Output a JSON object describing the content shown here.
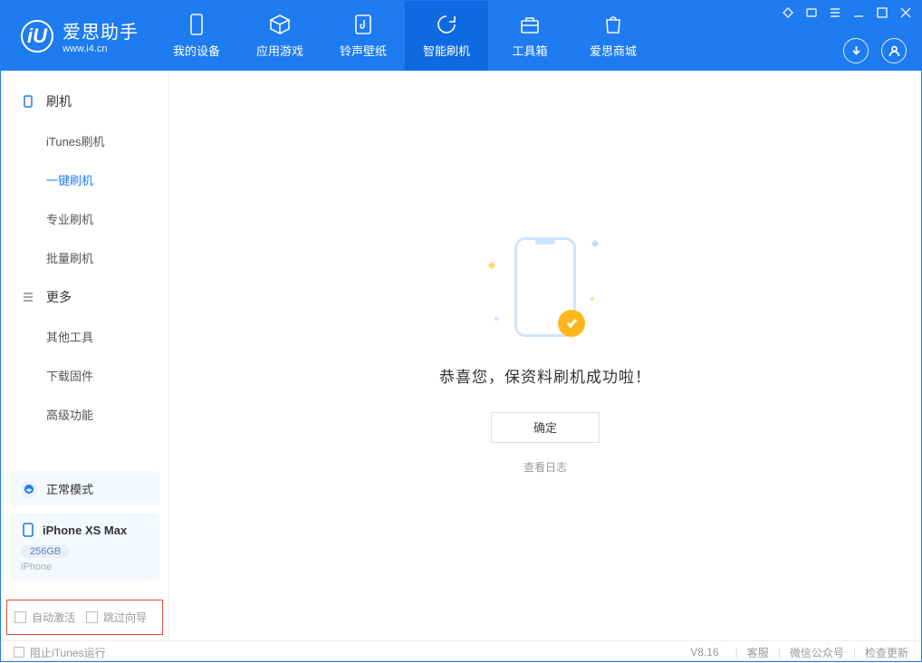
{
  "app": {
    "title": "爱思助手",
    "subtitle": "www.i4.cn",
    "logo_letter": "iU"
  },
  "nav": {
    "tabs": [
      {
        "label": "我的设备",
        "icon": "device"
      },
      {
        "label": "应用游戏",
        "icon": "cube"
      },
      {
        "label": "铃声壁纸",
        "icon": "music"
      },
      {
        "label": "智能刷机",
        "icon": "refresh",
        "active": true
      },
      {
        "label": "工具箱",
        "icon": "toolbox"
      },
      {
        "label": "爱思商城",
        "icon": "bag"
      }
    ]
  },
  "sidebar": {
    "group_flash": {
      "label": "刷机"
    },
    "items_flash": [
      {
        "label": "iTunes刷机"
      },
      {
        "label": "一键刷机",
        "active": true
      },
      {
        "label": "专业刷机"
      },
      {
        "label": "批量刷机"
      }
    ],
    "group_more": {
      "label": "更多"
    },
    "items_more": [
      {
        "label": "其他工具"
      },
      {
        "label": "下载固件"
      },
      {
        "label": "高级功能"
      }
    ],
    "mode": {
      "label": "正常模式"
    },
    "device": {
      "name": "iPhone XS Max",
      "storage": "256GB",
      "type": "iPhone"
    },
    "checkboxes": {
      "auto_activate": "自动激活",
      "skip_guide": "跳过向导"
    }
  },
  "main": {
    "success_message": "恭喜您，保资料刷机成功啦！",
    "ok_button": "确定",
    "view_log": "查看日志"
  },
  "footer": {
    "block_itunes": "阻止iTunes运行",
    "version": "V8.16",
    "links": {
      "customer_service": "客服",
      "wechat": "微信公众号",
      "check_update": "检查更新"
    }
  }
}
